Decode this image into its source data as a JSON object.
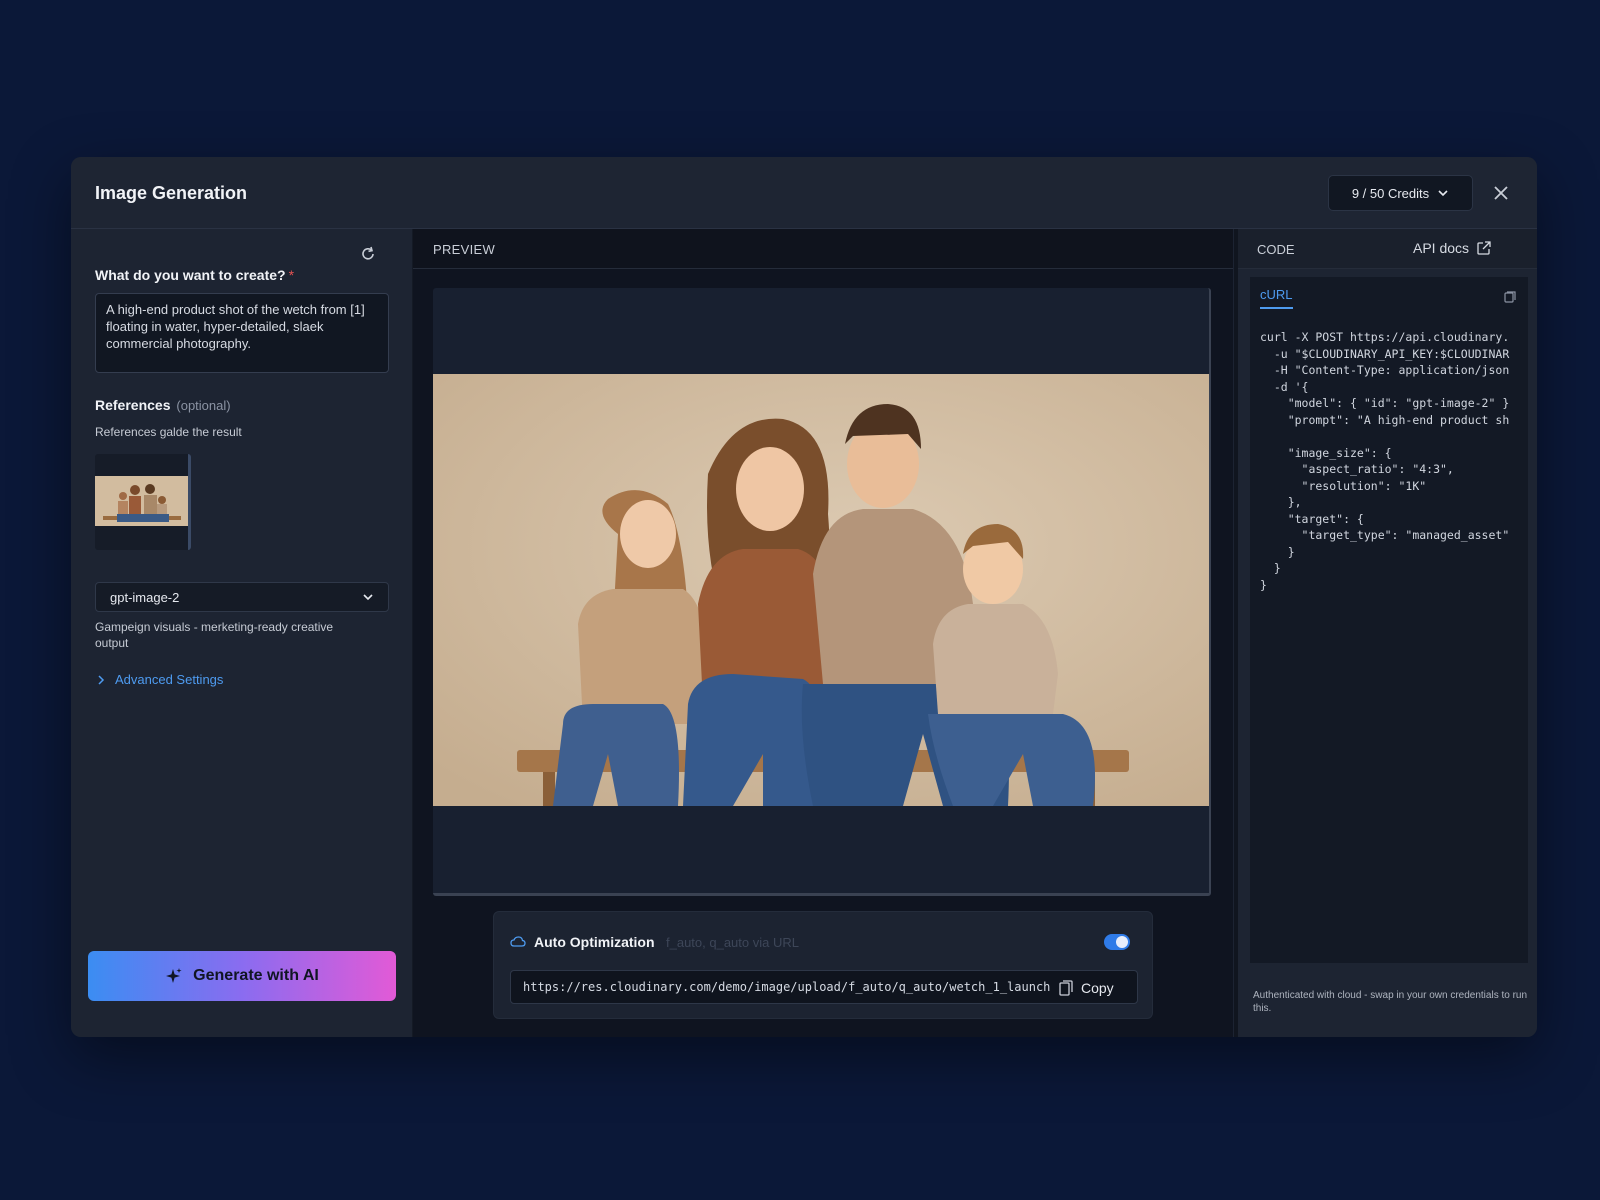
{
  "header": {
    "title": "Image Generation",
    "credits_label": "9 / 50  Credits"
  },
  "left": {
    "prompt_label": "What do you want to create?",
    "required_mark": "*",
    "prompt_value": "A high-end product shot of the wetch from [1] floating in water, hyper-detailed, slaek commercial photography.",
    "references_label": "References",
    "references_optional": "(optional)",
    "references_hint": "References galde the result",
    "model_selected": "gpt-image-2",
    "model_description": "Gampeign visuals - merketing-ready creative output",
    "advanced_label": "Advanced Settings",
    "generate_label": "Generate with AI"
  },
  "preview": {
    "header_label": "PREVIEW",
    "optimization_title": "Auto Optimization",
    "optimization_sub": "f_auto, q_auto via URL",
    "url": "https://res.cloudinary.com/demo/image/upload/f_auto/q_auto/wetch_1_launch",
    "copy_label": "Copy"
  },
  "code": {
    "header_label": "CODE",
    "api_docs_label": "API docs",
    "tab_label": "cURL",
    "snippet": "curl -X POST https://api.cloudinary.\n  -u \"$CLOUDINARY_API_KEY:$CLOUDINAR\n  -H \"Content-Type: application/json\n  -d '{\n    \"model\": { \"id\": \"gpt-image-2\" }\n    \"prompt\": \"A high-end product sh\n\n    \"image_size\": {\n      \"aspect_ratio\": \"4:3\",\n      \"resolution\": \"1K\"\n    },\n    \"target\": {\n      \"target_type\": \"managed_asset\"\n    }\n  }\n}",
    "auth_note": "Authenticated with cloud - swap in your own credentials to run this."
  },
  "colors": {
    "background": "#0b1838",
    "accent": "#4e9bf0",
    "toggle_on": "#2f7be8",
    "gradient_start": "#3b8df2",
    "gradient_end": "#e25ad6"
  }
}
